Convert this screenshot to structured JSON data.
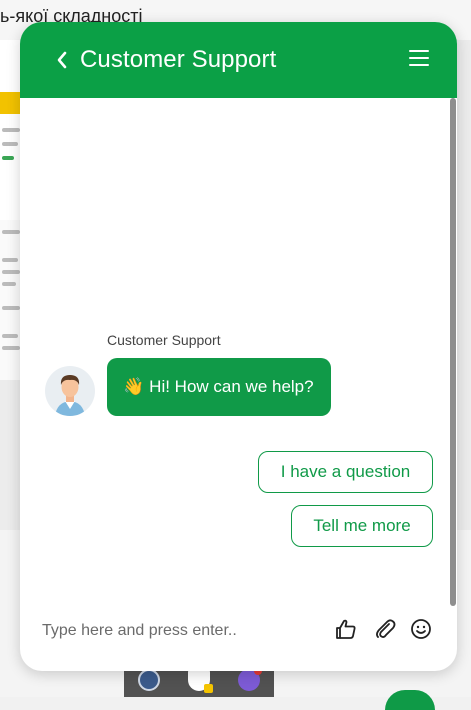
{
  "background_page": {
    "heading": "ь-якої складності"
  },
  "chat": {
    "title": "Customer Support",
    "sender_name": "Customer Support",
    "greeting_emoji": "👋",
    "greeting_text": "Hi! How can we help?",
    "quick_replies": [
      "I have a question",
      "Tell me more"
    ],
    "input_placeholder": "Type here and press enter..",
    "icons": {
      "back": "chevron-left-icon",
      "menu": "hamburger-menu-icon",
      "like": "thumbs-up-icon",
      "attach": "paperclip-icon",
      "emoji": "smiley-icon"
    }
  },
  "colors": {
    "brand_green": "#0ba046",
    "bubble_green": "#109a48"
  }
}
